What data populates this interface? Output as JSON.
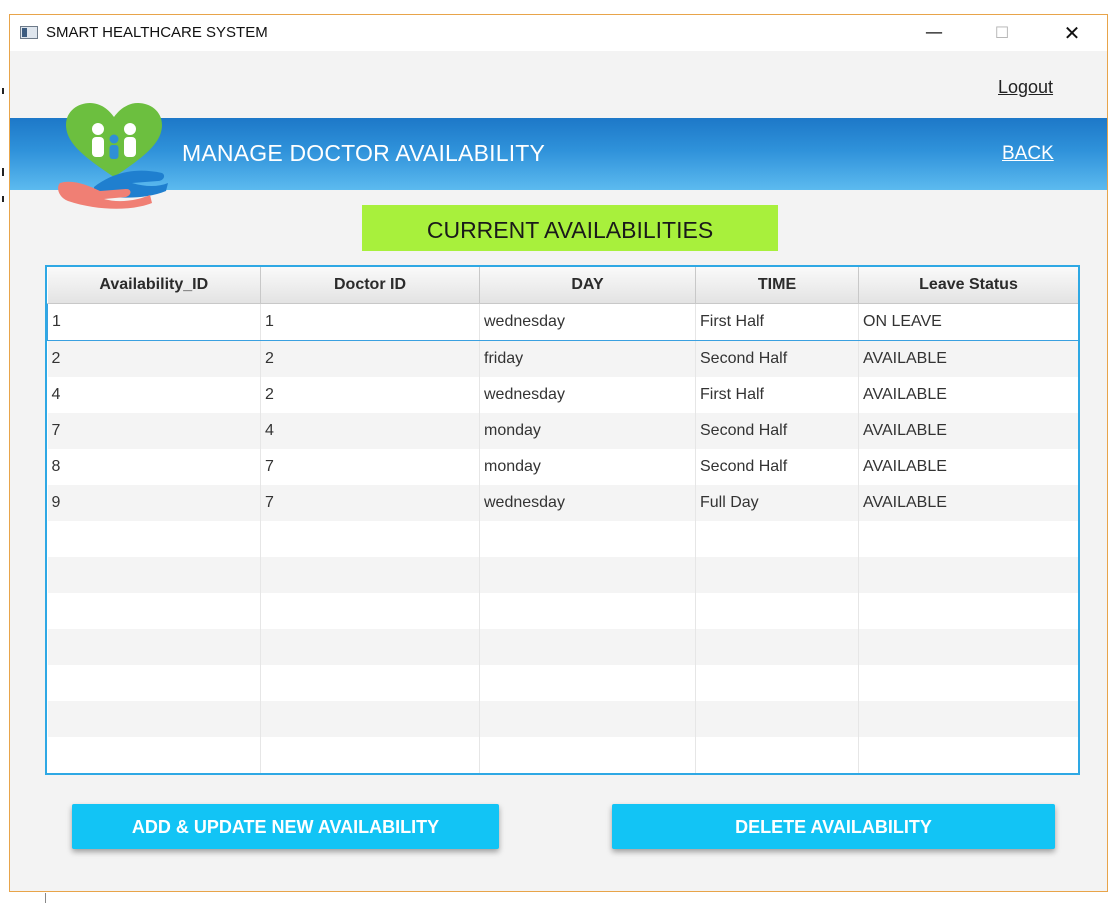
{
  "window": {
    "title": "SMART HEALTHCARE SYSTEM",
    "minimize_glyph": "—",
    "maximize_glyph": "☐",
    "close_glyph": "✕"
  },
  "header": {
    "logout_label": "Logout",
    "title": "MANAGE DOCTOR AVAILABILITY",
    "back_label": "BACK"
  },
  "section": {
    "label": "CURRENT AVAILABILITIES"
  },
  "table": {
    "columns": [
      "Availability_ID",
      "Doctor ID",
      "DAY",
      "TIME",
      "Leave Status"
    ],
    "rows": [
      [
        "1",
        "1",
        "wednesday",
        "First Half",
        "ON LEAVE"
      ],
      [
        "2",
        "2",
        "friday",
        "Second Half",
        "AVAILABLE"
      ],
      [
        "4",
        "2",
        "wednesday",
        "First Half",
        "AVAILABLE"
      ],
      [
        "7",
        "4",
        "monday",
        "Second Half",
        "AVAILABLE"
      ],
      [
        "8",
        "7",
        "monday",
        "Second Half",
        "AVAILABLE"
      ],
      [
        "9",
        "7",
        "wednesday",
        "Full Day",
        "AVAILABLE"
      ]
    ],
    "empty_rows": 7,
    "selected_row": 0
  },
  "actions": {
    "add_label": "ADD & UPDATE NEW AVAILABILITY",
    "delete_label": "DELETE AVAILABILITY"
  },
  "colors": {
    "banner": "#2f92da",
    "section_label_bg": "#a8f03c",
    "button_bg": "#12c4f5",
    "table_border": "#2ea8e4"
  },
  "icons": {
    "app": "app-window-icon",
    "logo": "healthcare-family-hands-logo"
  }
}
